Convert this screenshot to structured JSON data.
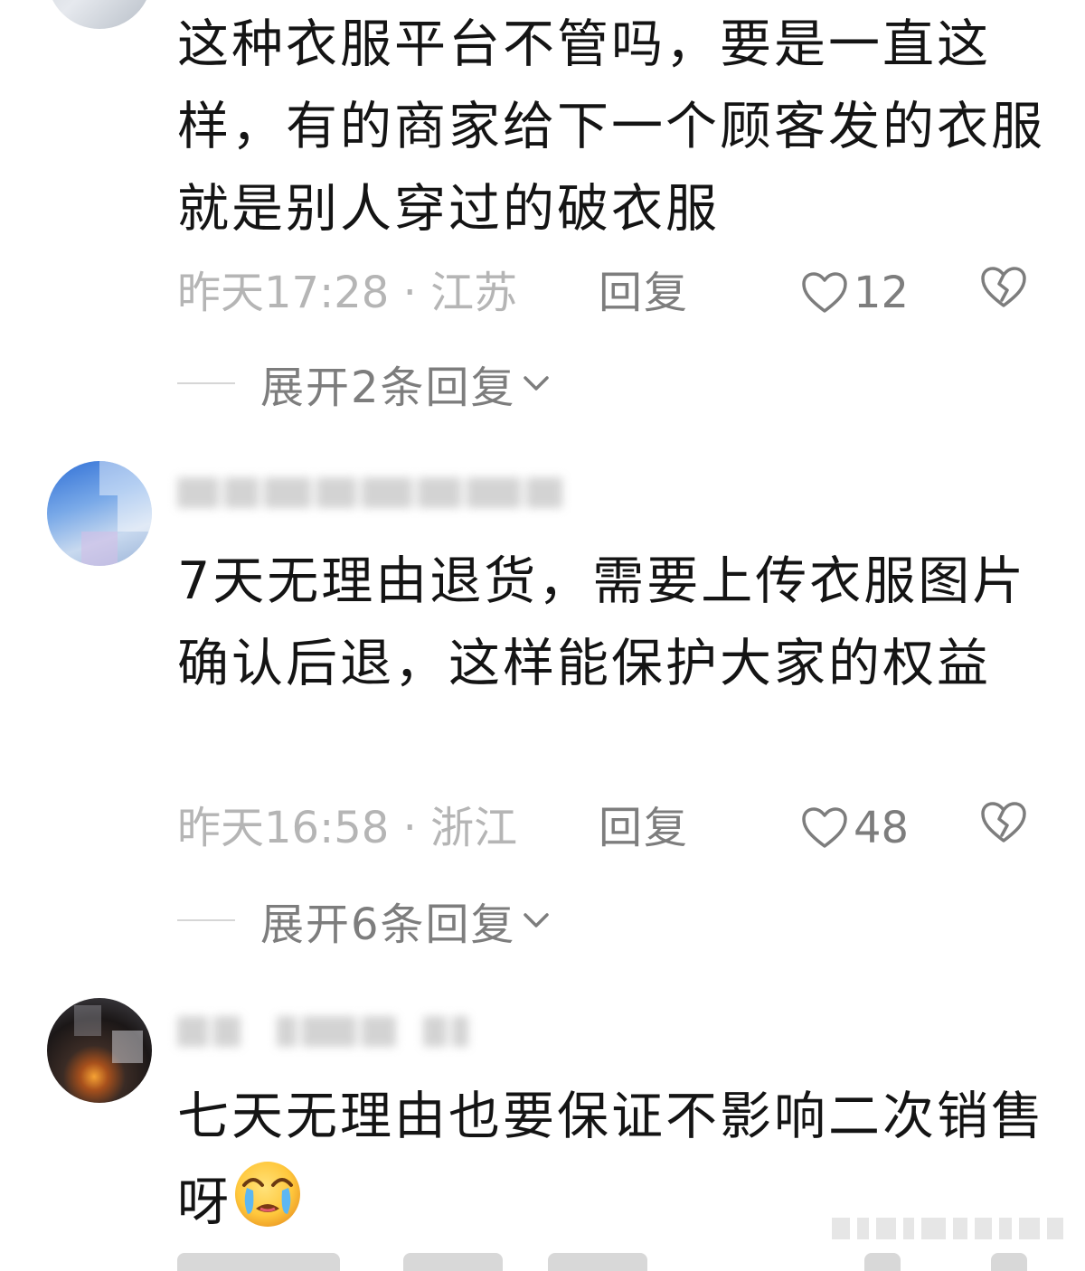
{
  "comments": [
    {
      "text": "这种衣服平台不管吗，要是一直这样，有的商家给下一个顾客发的衣服就是别人穿过的破衣服",
      "time": "昨天17:28 · 江苏",
      "reply_label": "回复",
      "likes": "12",
      "expand_label": "展开2条回复"
    },
    {
      "text": "7天无理由退货，需要上传衣服图片  确认后退，这样能保护大家的权益",
      "time": "昨天16:58 · 浙江",
      "reply_label": "回复",
      "likes": "48",
      "expand_label": "展开6条回复"
    },
    {
      "text": "七天无理由也要保证不影响二次销售呀",
      "emoji": "crying-face-emoji"
    }
  ],
  "icons": {
    "like": "heart-outline-icon",
    "dislike": "broken-heart-icon",
    "expand": "chevron-down-icon"
  },
  "colors": {
    "text": "#141414",
    "meta": "#b5b5b5",
    "action": "#7d7d7d"
  }
}
